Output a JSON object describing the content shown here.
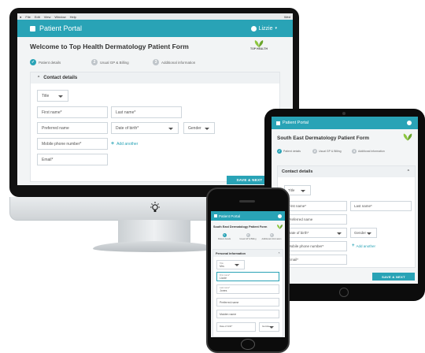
{
  "desktop": {
    "menubar": {
      "items": [
        "File",
        "Edit",
        "View",
        "Window",
        "Help"
      ],
      "right": "Wed"
    },
    "appbar": {
      "title": "Patient Portal",
      "user": "Lizzie"
    },
    "heading": "Welcome to Top Health Dermatology Patient Form",
    "logo_text": "TOP HEALTH",
    "steps": [
      {
        "num": "✓",
        "label": "Patient details"
      },
      {
        "num": "2",
        "label": "Usual GP & Billing"
      },
      {
        "num": "3",
        "label": "Additional information"
      }
    ],
    "section": "Contact details",
    "title_select": "Title",
    "first_name": "First name*",
    "last_name": "Last name*",
    "preferred_name": "Preferred name",
    "dob": "Date of birth*",
    "gender": "Gender",
    "mobile": "Mobile phone number*",
    "add_another": "Add another",
    "email": "Email*",
    "save_next": "SAVE & NEXT",
    "accent": "#29a3b6"
  },
  "tablet": {
    "appbar": {
      "title": "Patient Portal"
    },
    "heading": "South East Dermatology Patient Form",
    "steps": [
      {
        "num": "✓",
        "label": "Patient details"
      },
      {
        "num": "2",
        "label": "Usual GP & Billing"
      },
      {
        "num": "3",
        "label": "Additional information"
      }
    ],
    "section": "Contact details",
    "title_select": "Title",
    "first_name": "First name*",
    "last_name": "Last name*",
    "preferred_name": "Preferred name",
    "dob": "Date of birth*",
    "gender": "Gender",
    "mobile": "Mobile phone number*",
    "add_another": "Add another",
    "email": "Email*",
    "save_next": "SAVE & NEXT"
  },
  "phone": {
    "appbar": {
      "title": "Patient Portal"
    },
    "heading": "South East Dermatology Patient Form",
    "steps": [
      {
        "num": "1",
        "label": "Patient details"
      },
      {
        "num": "2",
        "label": "Usual GP & Billing"
      },
      {
        "num": "3",
        "label": "Additional information"
      }
    ],
    "section": "Personal information",
    "title_label": "Title",
    "title_value": "Mrs",
    "first_name_label": "First name*",
    "first_name_value": "Lizzie",
    "last_name_label": "Last name*",
    "last_name_value": "Jones",
    "preferred_name": "Preferred name",
    "maiden_name": "Maiden name",
    "dob_label": "Date of birth*",
    "gender": "Gender"
  }
}
